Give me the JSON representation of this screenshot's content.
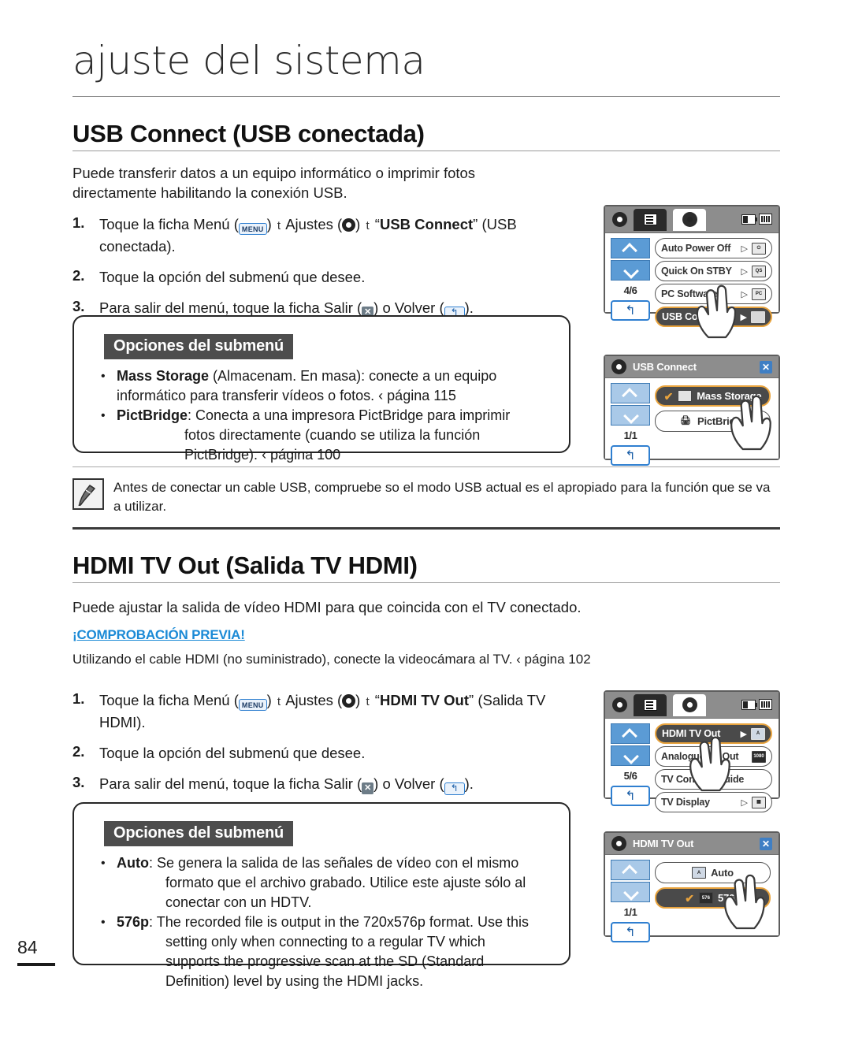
{
  "page": {
    "chapter_title": "ajuste del sistema",
    "folio": "84"
  },
  "sections": [
    {
      "heading": "USB Connect (USB conectada)",
      "intro": "Puede transferir datos a un equipo informático o imprimir fotos directamente habilitando la conexión USB.",
      "steps": [
        {
          "num": "1.",
          "pre": "Toque la ficha Menú (",
          "menu_icon": "MENU",
          "mid1": ") ",
          "arrow1": "t",
          "mid2": " Ajustes (",
          "gear_icon": "gear-icon",
          "mid3": ") ",
          "arrow2": "t",
          "mid4": " “",
          "bold": "USB Connect",
          "post": "” (USB conectada)."
        },
        {
          "num": "2.",
          "text": "Toque la opción del submenú que desee."
        },
        {
          "num": "3.",
          "pre": "Para salir del menú, toque la ficha Salir (",
          "exit_icon": "✕",
          "mid": ") o Volver (",
          "back_icon": "↰",
          "post": ")."
        }
      ],
      "options_box": {
        "header": "Opciones del submenú",
        "items": [
          {
            "bold": "Mass Storage",
            "rest": " (Almacenam. En masa): conecte a un equipo informático para transferir vídeos o fotos.",
            "pageref": "‹ página 115"
          },
          {
            "bold": "PictBridge",
            "rest": ": Conecta a una impresora PictBridge para imprimir fotos directamente (cuando se utiliza la función PictBridge).",
            "pageref": "‹ página 100"
          }
        ]
      },
      "note": "Antes de conectar un cable USB, compruebe so el modo USB actual es el apropiado para la función que se va a utilizar."
    },
    {
      "heading": "HDMI TV Out (Salida TV HDMI)",
      "intro": "Puede ajustar la salida de vídeo HDMI para que coincida con el TV conectado.",
      "precheck_label": "¡COMPROBACIÓN PREVIA!",
      "precheck_text": "Utilizando el cable HDMI (no suministrado), conecte la videocámara al TV.  ‹ página 102",
      "steps": [
        {
          "num": "1.",
          "pre": "Toque la ficha Menú (",
          "menu_icon": "MENU",
          "mid1": ") ",
          "arrow1": "t",
          "mid2": " Ajustes (",
          "gear_icon": "gear-icon",
          "mid3": ") ",
          "arrow2": "t",
          "mid4": " “",
          "bold": "HDMI TV Out",
          "post": "” (Salida TV HDMI)."
        },
        {
          "num": "2.",
          "text": "Toque la opción del submenú que desee."
        },
        {
          "num": "3.",
          "pre": "Para salir del menú, toque la ficha Salir (",
          "exit_icon": "✕",
          "mid": ") o Volver (",
          "back_icon": "↰",
          "post": ")."
        }
      ],
      "options_box": {
        "header": "Opciones del submenú",
        "items": [
          {
            "bold": "Auto",
            "rest": ": Se genera la salida de las señales de vídeo con el mismo formato que el archivo grabado. Utilice este ajuste sólo al conectar con un HDTV.",
            "pageref": ""
          },
          {
            "bold": "576p",
            "rest": ": The recorded file is output in the 720x576p format. Use this setting only when connecting to a regular TV which supports the progressive scan at the SD (Standard Definition) level by using the HDMI jacks.",
            "pageref": ""
          }
        ]
      }
    }
  ],
  "screens": [
    {
      "id": "usb-menu-screen",
      "type": "menu-list",
      "tabs": [
        "list-icon",
        "gear-icon"
      ],
      "status_icons": [
        "battery-icon",
        "card-icon"
      ],
      "pager": "4/6",
      "rows": [
        {
          "label": "Auto Power Off",
          "arrow": "▷",
          "icon": "power-off-icon",
          "selected": false
        },
        {
          "label": "Quick On STBY",
          "arrow": "▷",
          "icon": "quick-on-icon",
          "selected": false
        },
        {
          "label": "PC Software",
          "arrow": "▷",
          "icon": "pc-software-icon",
          "selected": false
        },
        {
          "label": "USB Connect",
          "arrow": "▶",
          "icon": "usb-icon",
          "selected": true
        }
      ],
      "back_icon": "↰"
    },
    {
      "id": "usb-connect-submenu-screen",
      "type": "submenu",
      "title": "USB Connect",
      "close": "✕",
      "pager": "1/1",
      "rows": [
        {
          "label": "Mass Storage",
          "icon": "mass-storage-icon",
          "selected": true,
          "check": "✔"
        },
        {
          "label": "PictBridge",
          "icon": "pictbridge-icon",
          "selected": false,
          "check": ""
        }
      ],
      "back_icon": "↰"
    },
    {
      "id": "hdmi-menu-screen",
      "type": "menu-list",
      "tabs": [
        "list-icon",
        "gear-icon"
      ],
      "status_icons": [
        "battery-icon",
        "card-icon"
      ],
      "pager": "5/6",
      "rows": [
        {
          "label": "HDMI TV Out",
          "arrow": "▶",
          "icon": "auto-icon",
          "selected": true
        },
        {
          "label": "Analogue TV Out",
          "arrow": "",
          "icon": "1080i-icon",
          "selected": false
        },
        {
          "label": "TV Connect Guide",
          "arrow": "",
          "icon": "",
          "selected": false
        },
        {
          "label": "TV Display",
          "arrow": "▷",
          "icon": "tv-display-icon",
          "selected": false
        }
      ],
      "back_icon": "↰"
    },
    {
      "id": "hdmi-tv-out-submenu-screen",
      "type": "submenu",
      "title": "HDMI TV Out",
      "close": "✕",
      "pager": "1/1",
      "rows": [
        {
          "label": "Auto",
          "icon": "auto-icon",
          "selected": false,
          "check": ""
        },
        {
          "label": "576p",
          "icon": "576p-icon",
          "selected": true,
          "check": "✔"
        }
      ],
      "back_icon": "↰"
    }
  ]
}
